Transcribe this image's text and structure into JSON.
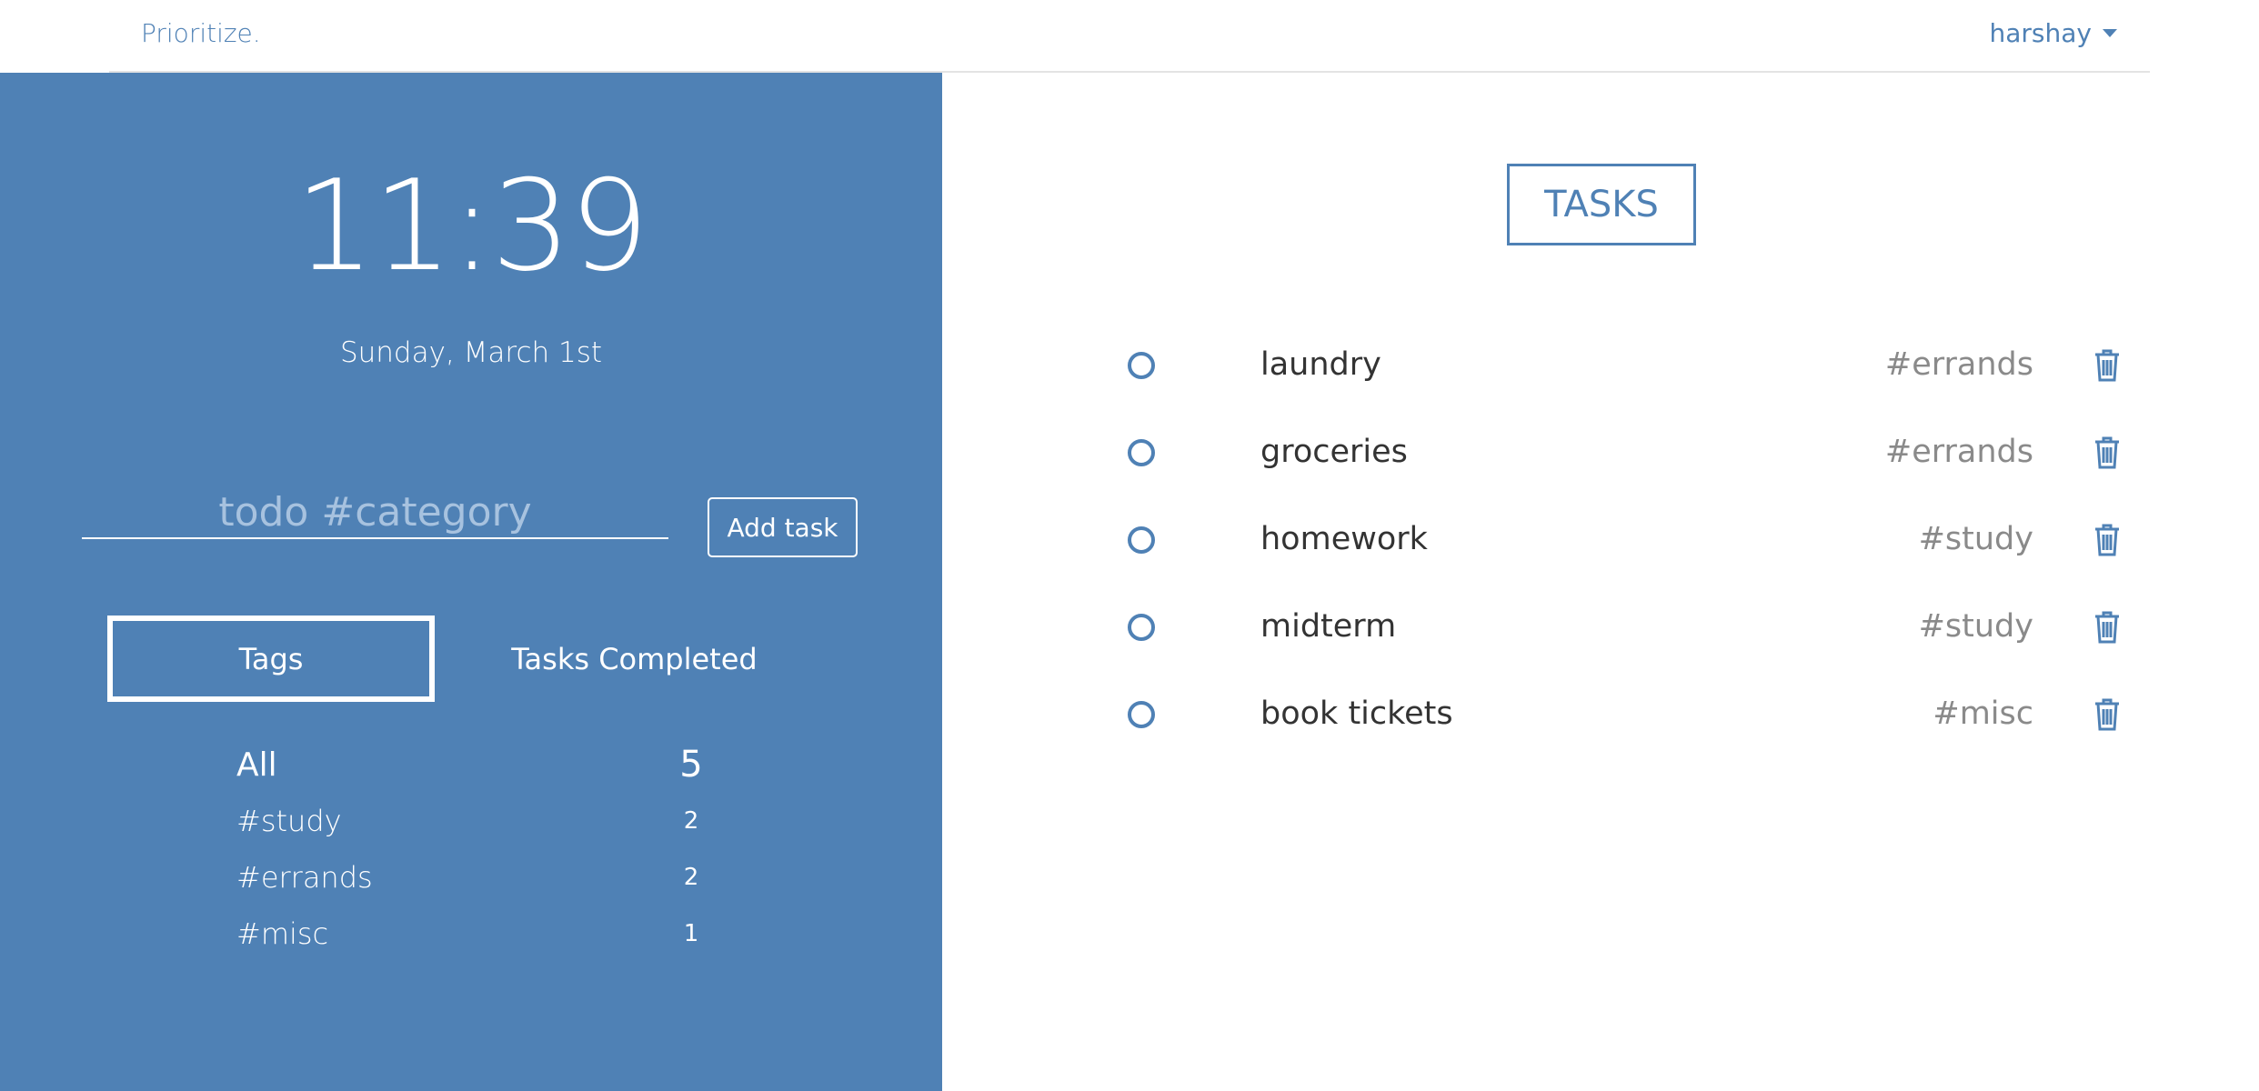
{
  "navbar": {
    "brand": "Prioritize.",
    "user": "harshay"
  },
  "sidebar": {
    "clock": "11:39",
    "date": "Sunday, March 1st",
    "input_placeholder": "todo #category",
    "input_value": "",
    "add_button": "Add task",
    "tabs": {
      "tags": "Tags",
      "completed": "Tasks Completed"
    },
    "active_tab": "Tags",
    "tags": [
      {
        "name": "All",
        "count": "5"
      },
      {
        "name": "#study",
        "count": "2"
      },
      {
        "name": "#errands",
        "count": "2"
      },
      {
        "name": "#misc",
        "count": "1"
      }
    ]
  },
  "main": {
    "title": "TASKS",
    "tasks": [
      {
        "name": "laundry",
        "tag": "#errands"
      },
      {
        "name": "groceries",
        "tag": "#errands"
      },
      {
        "name": "homework",
        "tag": "#study"
      },
      {
        "name": "midterm",
        "tag": "#study"
      },
      {
        "name": "book tickets",
        "tag": "#misc"
      }
    ]
  },
  "icons": {
    "check": "circle-check-icon",
    "delete": "trash-icon",
    "menu": "caret-down-icon"
  },
  "colors": {
    "accent": "#4f81b5",
    "text": "#333333",
    "muted": "#8a8a8a",
    "placeholder": "#a7c2df"
  }
}
